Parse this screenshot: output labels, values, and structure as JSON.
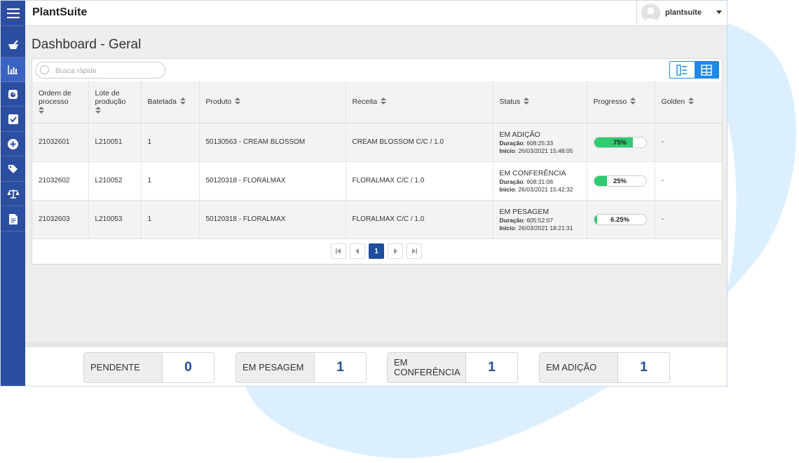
{
  "app": {
    "title": "PlantSuite",
    "user": "plantsuite"
  },
  "page": {
    "title": "Dashboard - Geral"
  },
  "search": {
    "placeholder": "Busca rápida"
  },
  "table": {
    "columns": {
      "ordem": [
        "Ordem de",
        "processo"
      ],
      "lote": [
        "Lote de",
        "produção"
      ],
      "batelada": "Batelada",
      "produto": "Produto",
      "receita": "Receita",
      "status": "Status",
      "progresso": "Progresso",
      "golden": "Golden"
    },
    "rows": [
      {
        "ordem": "21032601",
        "lote": "L210051",
        "batelada": "1",
        "produto": "50130563 - CREAM BLOSSOM",
        "receita": "CREAM BLOSSOM C/C / 1.0",
        "status": "EM ADIÇÃO",
        "duracao": "608:25:33",
        "inicio": "26/03/2021 15:48:05",
        "progress_text": "75%",
        "progress_fraction": 0.75,
        "golden": "-"
      },
      {
        "ordem": "21032602",
        "lote": "L210052",
        "batelada": "1",
        "produto": "50120318 - FLORALMAX",
        "receita": "FLORALMAX C/C / 1.0",
        "status": "EM CONFERÊNCIA",
        "duracao": "608:31:06",
        "inicio": "26/03/2021 15:42:32",
        "progress_text": "25%",
        "progress_fraction": 0.25,
        "golden": "-"
      },
      {
        "ordem": "21032603",
        "lote": "L210053",
        "batelada": "1",
        "produto": "50120318 - FLORALMAX",
        "receita": "FLORALMAX C/C / 1.0",
        "status": "EM PESAGEM",
        "duracao": "605:52:07",
        "inicio": "26/03/2021 18:21:31",
        "progress_text": "6.25%",
        "progress_fraction": 0.0625,
        "golden": "-"
      }
    ],
    "labels": {
      "duracao": "Duração",
      "inicio": "Início"
    }
  },
  "pagination": {
    "current": "1"
  },
  "summary": [
    {
      "label": "PENDENTE",
      "value": "0"
    },
    {
      "label": "EM PESAGEM",
      "value": "1"
    },
    {
      "label": "EM CONFERÊNCIA",
      "value": "1"
    },
    {
      "label": "EM ADIÇÃO",
      "value": "1"
    }
  ],
  "colors": {
    "sidebar": "#2c4ea0",
    "accent": "#1e88e5",
    "progress": "#2ecc71",
    "counter": "#1f4e9c"
  }
}
